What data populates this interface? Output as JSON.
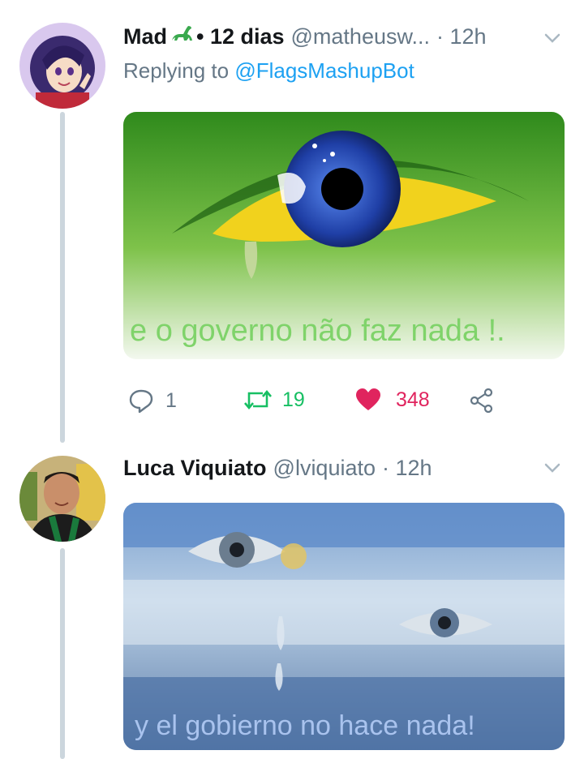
{
  "tweets": [
    {
      "display_name": "Mad",
      "emoji_name": "sauropod-emoji",
      "bullet": "• 12 dias",
      "handle": "@matheusw...",
      "time": "· 12h",
      "replying_prefix": "Replying to",
      "replying_handle": "@FlagsMashupBot",
      "media_caption": "e o governo não faz nada !.",
      "stats": {
        "replies": "1",
        "retweets": "19",
        "likes": "348"
      },
      "colors": {
        "retweet": "#17bf63",
        "like": "#e0245e",
        "caption": "#7fd36a"
      }
    },
    {
      "display_name": "Luca Viquiato",
      "handle": "@lviquiato",
      "time": "· 12h",
      "media_caption": "y el gobierno no hace nada!",
      "colors": {
        "caption": "#a9c3ee"
      }
    }
  ]
}
